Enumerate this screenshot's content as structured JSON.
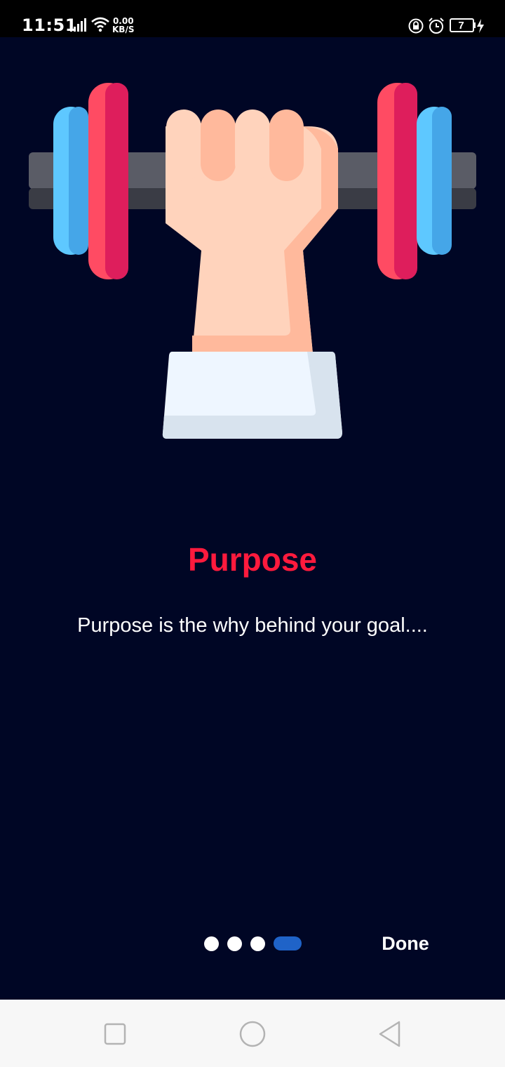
{
  "status_bar": {
    "time": "11:51",
    "net_speed_value": "0.00",
    "net_speed_unit": "KB/S",
    "battery_level": "7"
  },
  "onboarding": {
    "title": "Purpose",
    "subtitle": "Purpose is the why behind your goal....",
    "page_indicator": {
      "total": 4,
      "current": 4
    },
    "done_label": "Done"
  },
  "colors": {
    "background": "#000625",
    "title": "#ff1a3d",
    "active_dot": "#1f63c8"
  },
  "icons": {
    "hero": "hand-lifting-dumbbell-illustration",
    "nav_recents": "square-icon",
    "nav_home": "circle-icon",
    "nav_back": "triangle-back-icon"
  }
}
